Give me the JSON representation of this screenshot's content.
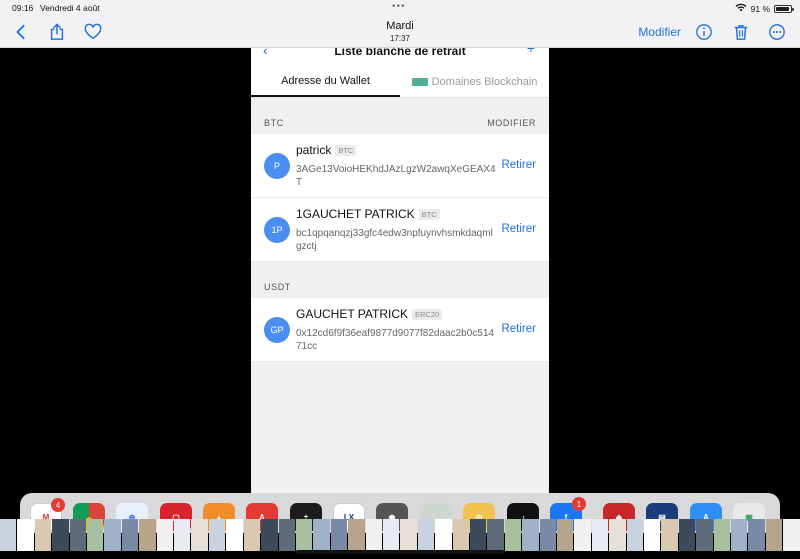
{
  "status": {
    "time": "09:16",
    "date": "Vendredi 4 août",
    "battery": "91 %",
    "battery_level": 0.91
  },
  "toolbar": {
    "title": "Mardi",
    "subtitle": "17:37",
    "edit_label": "Modifier"
  },
  "app": {
    "header_title": "Liste blanche de retrait",
    "tabs": [
      {
        "label": "Adresse du Wallet",
        "active": true
      },
      {
        "label": "Domaines Blockchain",
        "active": false
      }
    ],
    "sections": [
      {
        "name": "BTC",
        "action": "MODIFIER",
        "entries": [
          {
            "initials": "P",
            "name": "patrick",
            "chip": "BTC",
            "address": "3AGe13VoioHEKhdJAzLgzW2awqXeGEAX4T",
            "action": "Retirer"
          },
          {
            "initials": "1P",
            "name": "1GAUCHET PATRICK",
            "chip": "BTC",
            "address": "bc1qpqanqzj33gfc4edw3npfuynvhsmkdaqmlgzctj",
            "action": "Retirer"
          }
        ]
      },
      {
        "name": "USDT",
        "action": "",
        "entries": [
          {
            "initials": "GP",
            "name": "GAUCHET PATRICK",
            "chip": "ERC20",
            "address": "0x12cd6f9f36eaf9877d9077f82daac2b0c51471cc",
            "action": "Retirer"
          }
        ]
      }
    ]
  },
  "dock": {
    "badges": {
      "gmail": "4",
      "facebook": "1"
    }
  },
  "colors": {
    "accent": "#1f6fdd",
    "avatar": "#4b8ef1",
    "badge": "#e53935"
  }
}
